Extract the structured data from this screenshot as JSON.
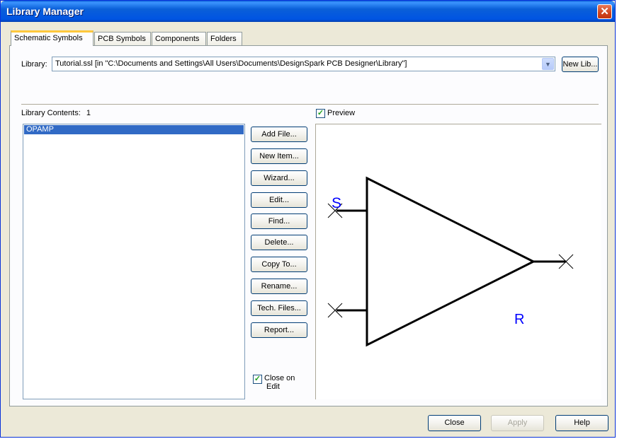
{
  "window": {
    "title": "Library Manager"
  },
  "tabs": [
    {
      "label": "Schematic Symbols",
      "active": true
    },
    {
      "label": "PCB Symbols",
      "active": false
    },
    {
      "label": "Components",
      "active": false
    },
    {
      "label": "Folders",
      "active": false
    }
  ],
  "library": {
    "label": "Library:",
    "selected": "Tutorial.ssl   [in \"C:\\Documents and Settings\\All Users\\Documents\\DesignSpark PCB Designer\\Library\"]",
    "new_lib_button": "New Lib..."
  },
  "contents": {
    "label": "Library Contents:",
    "count": "1",
    "items": [
      "OPAMP"
    ]
  },
  "preview": {
    "label": "Preview",
    "checked": true,
    "symbol_labels": {
      "pin_top": "S",
      "pin_right": "R"
    },
    "line_color": "#000000",
    "label_color": "#0000ff"
  },
  "actions": [
    "Add File...",
    "New Item...",
    "Wizard...",
    "Edit...",
    "Find...",
    "Delete...",
    "Copy To...",
    "Rename...",
    "Tech. Files...",
    "Report..."
  ],
  "close_on_edit": {
    "line1": "Close on",
    "line2": "Edit",
    "checked": true
  },
  "footer": {
    "close": "Close",
    "apply": "Apply",
    "help": "Help"
  },
  "colors": {
    "title_bar": "#0054e3",
    "selection": "#316ac5",
    "dialog_bg": "#ece9d8"
  }
}
